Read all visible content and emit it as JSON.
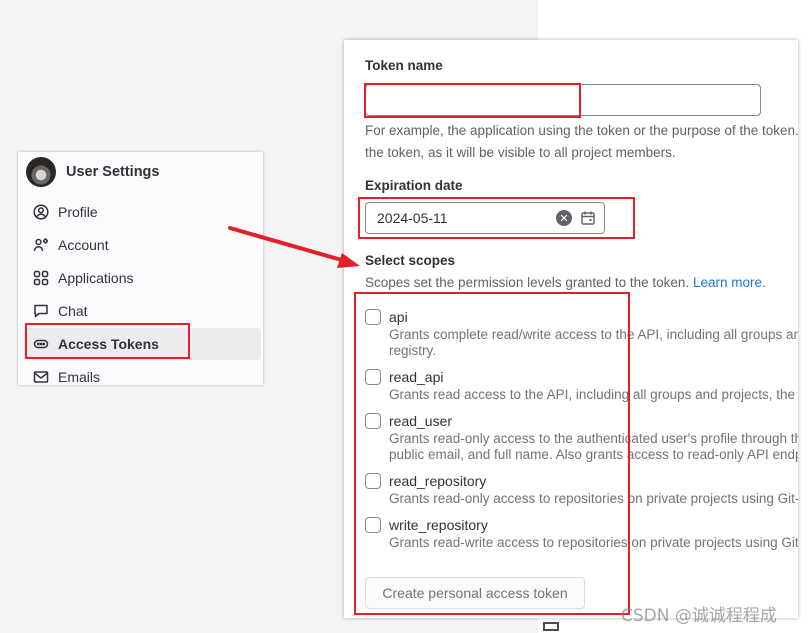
{
  "sidebar": {
    "title": "User Settings",
    "items": [
      {
        "label": "Profile",
        "icon": "profile-icon"
      },
      {
        "label": "Account",
        "icon": "account-icon"
      },
      {
        "label": "Applications",
        "icon": "applications-icon"
      },
      {
        "label": "Chat",
        "icon": "chat-icon"
      },
      {
        "label": "Access Tokens",
        "icon": "token-icon",
        "active": true
      },
      {
        "label": "Emails",
        "icon": "mail-icon"
      }
    ]
  },
  "form": {
    "token_name": {
      "label": "Token name",
      "value": "",
      "help_line1": "For example, the application using the token or the purpose of the token. Do not give sensitive information for the name of",
      "help_line2": "the token, as it will be visible to all project members."
    },
    "expiration": {
      "label": "Expiration date",
      "value": "2024-05-11",
      "clear_icon": "✕"
    },
    "scopes": {
      "label": "Select scopes",
      "help": "Scopes set the permission levels granted to the token.",
      "learn_more": "Learn more.",
      "items": [
        {
          "name": "api",
          "checked": false,
          "desc_line1": "Grants complete read/write access to the API, including all groups and projects, the container registry, and the package",
          "desc_line2": "registry."
        },
        {
          "name": "read_api",
          "checked": false,
          "desc_line1": "Grants read access to the API, including all groups and projects, the container registry, and the package registry.",
          "desc_line2": ""
        },
        {
          "name": "read_user",
          "checked": false,
          "desc_line1": "Grants read-only access to the authenticated user's profile through the /user API endpoint, which includes username,",
          "desc_line2": "public email, and full name. Also grants access to read-only API endpoints under /users."
        },
        {
          "name": "read_repository",
          "checked": false,
          "desc_line1": "Grants read-only access to repositories on private projects using Git-over-HTTP or the Repository Files API.",
          "desc_line2": ""
        },
        {
          "name": "write_repository",
          "checked": false,
          "desc_line1": "Grants read-write access to repositories on private projects using Git-over-HTTP (not using the API).",
          "desc_line2": ""
        }
      ]
    },
    "submit_label": "Create personal access token"
  },
  "annotation_color": "#e3202a",
  "watermark": "CSDN @诚诚程程成"
}
